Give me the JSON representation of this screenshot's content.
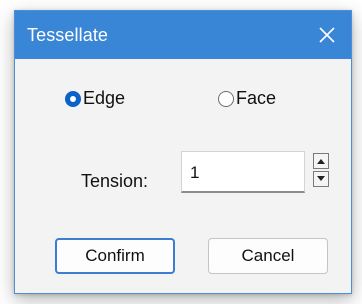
{
  "window": {
    "title": "Tessellate"
  },
  "titlebar": {
    "close_icon": "close-icon"
  },
  "mode": {
    "options": [
      {
        "label": "Edge",
        "selected": true
      },
      {
        "label": "Face",
        "selected": false
      }
    ]
  },
  "tension": {
    "label": "Tension:",
    "value": "1"
  },
  "buttons": {
    "confirm": "Confirm",
    "cancel": "Cancel"
  },
  "colors": {
    "titlebar": "#3a86d6",
    "accent": "#0a62c9"
  }
}
